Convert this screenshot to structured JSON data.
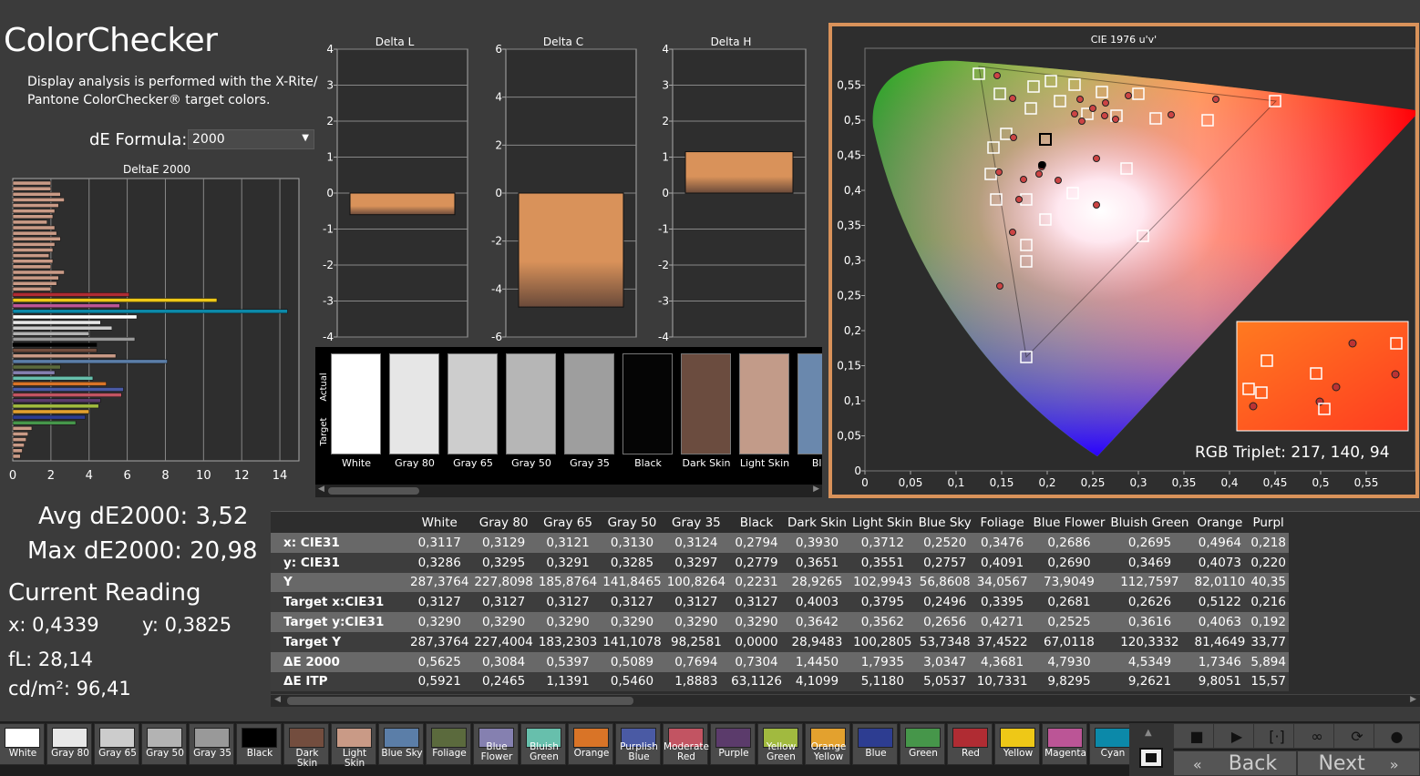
{
  "app": {
    "title": "ColorChecker",
    "description": "Display analysis is performed with the X-Rite/ Pantone ColorChecker® target colors.",
    "formula_label": "dE Formula:",
    "formula_value": "2000"
  },
  "deltae_chart": {
    "title": "DeltaE 2000",
    "x_ticks": [
      "0",
      "2",
      "4",
      "6",
      "8",
      "10",
      "12",
      "14"
    ],
    "xlim": [
      0,
      15
    ]
  },
  "delta_l": {
    "title": "Delta L",
    "ticks": [
      "4",
      "3",
      "2",
      "1",
      "0",
      "-1",
      "-2",
      "-3",
      "-4"
    ],
    "ylim": [
      -4,
      4
    ],
    "value": -0.6,
    "color": "#d9925a"
  },
  "delta_c": {
    "title": "Delta C",
    "ticks": [
      "6",
      "4",
      "2",
      "0",
      "-2",
      "-4",
      "-6"
    ],
    "ylim": [
      -6,
      6
    ],
    "value": -4.75,
    "color": "#d9925a"
  },
  "delta_h": {
    "title": "Delta H",
    "ticks": [
      "4",
      "3",
      "2",
      "1",
      "0",
      "-1",
      "-2",
      "-3",
      "-4"
    ],
    "ylim": [
      -4,
      4
    ],
    "value": 1.15,
    "color": "#d9925a"
  },
  "swatch_strip": {
    "actual_label": "Actual",
    "target_label": "Target",
    "items": [
      {
        "label": "White",
        "color": "#ffffff"
      },
      {
        "label": "Gray 80",
        "color": "#e6e6e6"
      },
      {
        "label": "Gray 65",
        "color": "#cdcdcd"
      },
      {
        "label": "Gray 50",
        "color": "#b6b6b6"
      },
      {
        "label": "Gray 35",
        "color": "#9e9e9e"
      },
      {
        "label": "Black",
        "color": "#050505"
      },
      {
        "label": "Dark Skin",
        "color": "#6b4c3f"
      },
      {
        "label": "Light Skin",
        "color": "#c29b89"
      },
      {
        "label": "Blue",
        "color": "#6a88ad"
      }
    ]
  },
  "cie": {
    "title": "CIE 1976 u'v'",
    "x_ticks": [
      "0",
      "0,05",
      "0,1",
      "0,15",
      "0,2",
      "0,25",
      "0,3",
      "0,35",
      "0,4",
      "0,45",
      "0,5",
      "0,55"
    ],
    "y_ticks": [
      "0",
      "0,05",
      "0,1",
      "0,15",
      "0,2",
      "0,25",
      "0,3",
      "0,35",
      "0,4",
      "0,45",
      "0,5",
      "0,55"
    ],
    "rgb_triplet": "RGB Triplet: 217, 140, 94"
  },
  "stats": {
    "avg": "Avg dE2000: 3,52",
    "max": "Max dE2000: 20,98",
    "current_reading": "Current Reading",
    "x": "x: 0,4339",
    "y": "y: 0,3825",
    "fl": "fL: 28,14",
    "cd": "cd/m²: 96,41"
  },
  "table": {
    "columns": [
      "White",
      "Gray 80",
      "Gray 65",
      "Gray 50",
      "Gray 35",
      "Black",
      "Dark Skin",
      "Light Skin",
      "Blue Sky",
      "Foliage",
      "Blue Flower",
      "Bluish Green",
      "Orange",
      "Purpl"
    ],
    "rows": [
      {
        "label": "x: CIE31",
        "values": [
          "0,3117",
          "0,3129",
          "0,3121",
          "0,3130",
          "0,3124",
          "0,2794",
          "0,3930",
          "0,3712",
          "0,2520",
          "0,3476",
          "0,2686",
          "0,2695",
          "0,4964",
          "0,218"
        ]
      },
      {
        "label": "y: CIE31",
        "values": [
          "0,3286",
          "0,3295",
          "0,3291",
          "0,3285",
          "0,3297",
          "0,2779",
          "0,3651",
          "0,3551",
          "0,2757",
          "0,4091",
          "0,2690",
          "0,3469",
          "0,4073",
          "0,220"
        ]
      },
      {
        "label": "Y",
        "values": [
          "287,3764",
          "227,8098",
          "185,8764",
          "141,8465",
          "100,8264",
          "0,2231",
          "28,9265",
          "102,9943",
          "56,8608",
          "34,0567",
          "73,9049",
          "112,7597",
          "82,0110",
          "40,35"
        ]
      },
      {
        "label": "Target x:CIE31",
        "values": [
          "0,3127",
          "0,3127",
          "0,3127",
          "0,3127",
          "0,3127",
          "0,3127",
          "0,4003",
          "0,3795",
          "0,2496",
          "0,3395",
          "0,2681",
          "0,2626",
          "0,5122",
          "0,216"
        ]
      },
      {
        "label": "Target y:CIE31",
        "values": [
          "0,3290",
          "0,3290",
          "0,3290",
          "0,3290",
          "0,3290",
          "0,3290",
          "0,3642",
          "0,3562",
          "0,2656",
          "0,4271",
          "0,2525",
          "0,3616",
          "0,4063",
          "0,192"
        ]
      },
      {
        "label": "Target Y",
        "values": [
          "287,3764",
          "227,4004",
          "183,2303",
          "141,1078",
          "98,2581",
          "0,0000",
          "28,9483",
          "100,2805",
          "53,7348",
          "37,4522",
          "67,0118",
          "120,3332",
          "81,4649",
          "33,77"
        ]
      },
      {
        "label": "ΔE 2000",
        "values": [
          "0,5625",
          "0,3084",
          "0,5397",
          "0,5089",
          "0,7694",
          "0,7304",
          "1,4450",
          "1,7935",
          "3,0347",
          "4,3681",
          "4,7930",
          "4,5349",
          "1,7346",
          "5,894"
        ]
      },
      {
        "label": "ΔE ITP",
        "values": [
          "0,5921",
          "0,2465",
          "1,1391",
          "0,5460",
          "1,8883",
          "63,1126",
          "4,1099",
          "5,1180",
          "5,0537",
          "10,7331",
          "9,8295",
          "9,2621",
          "9,8051",
          "15,57"
        ]
      }
    ]
  },
  "patches": [
    {
      "label": "White",
      "color": "#ffffff"
    },
    {
      "label": "Gray 80",
      "color": "#e8e8e8"
    },
    {
      "label": "Gray 65",
      "color": "#cccccc"
    },
    {
      "label": "Gray 50",
      "color": "#b3b3b3"
    },
    {
      "label": "Gray 35",
      "color": "#999999"
    },
    {
      "label": "Black",
      "color": "#000000"
    },
    {
      "label": "Dark Skin",
      "color": "#734d3e"
    },
    {
      "label": "Light Skin",
      "color": "#c99a86"
    },
    {
      "label": "Blue Sky",
      "color": "#5b7ea8"
    },
    {
      "label": "Foliage",
      "color": "#5b6a3d"
    },
    {
      "label": "Blue Flower",
      "color": "#8580b0"
    },
    {
      "label": "Bluish Green",
      "color": "#67bfac"
    },
    {
      "label": "Orange",
      "color": "#d97427"
    },
    {
      "label": "Purplish Blue",
      "color": "#4a5aa4"
    },
    {
      "label": "Moderate Red",
      "color": "#c25462"
    },
    {
      "label": "Purple",
      "color": "#5b3b6b"
    },
    {
      "label": "Yellow Green",
      "color": "#a1ba3f"
    },
    {
      "label": "Orange Yellow",
      "color": "#e3a12e"
    },
    {
      "label": "Blue",
      "color": "#2d3d91"
    },
    {
      "label": "Green",
      "color": "#46964a"
    },
    {
      "label": "Red",
      "color": "#b02c33"
    },
    {
      "label": "Yellow",
      "color": "#eec817"
    },
    {
      "label": "Magenta",
      "color": "#bb5596"
    },
    {
      "label": "Cyan",
      "color": "#0c89a9"
    }
  ],
  "nav": {
    "back": "Back",
    "next": "Next"
  },
  "colors": {
    "accent": "#d9925a",
    "panel_border": "#d9925a"
  }
}
